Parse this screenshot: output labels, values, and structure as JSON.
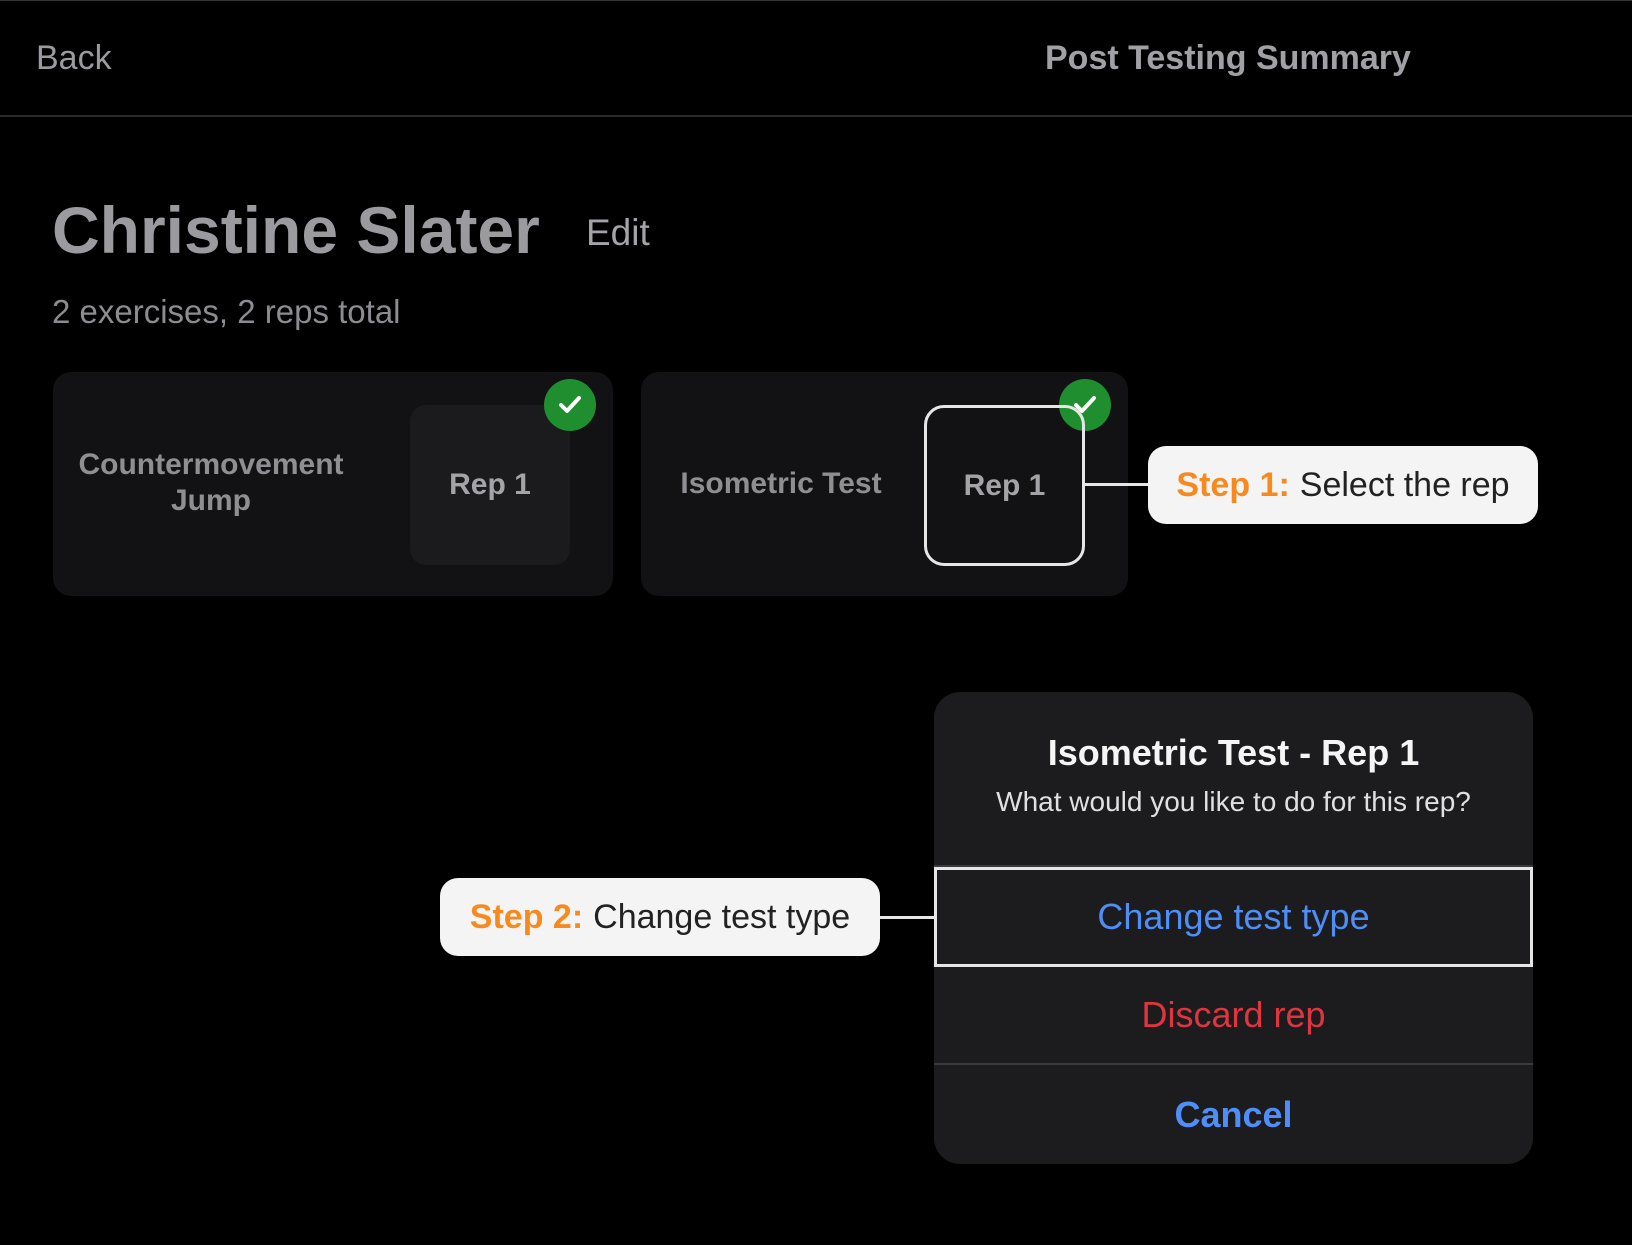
{
  "nav": {
    "back_label": "Back",
    "title": "Post Testing Summary"
  },
  "athlete": {
    "name": "Christine Slater",
    "edit_label": "Edit",
    "summary": "2 exercises, 2 reps total"
  },
  "exercises": [
    {
      "name": "Countermovement Jump",
      "rep_label": "Rep 1",
      "status_icon": "check-icon"
    },
    {
      "name": "Isometric Test",
      "rep_label": "Rep 1",
      "status_icon": "check-icon"
    }
  ],
  "callouts": {
    "step1": {
      "step": "Step 1:",
      "text": "Select the rep"
    },
    "step2": {
      "step": "Step 2:",
      "text": "Change test type"
    }
  },
  "action_sheet": {
    "title": "Isometric Test - Rep 1",
    "subtitle": "What would you like to do for this rep?",
    "change_label": "Change test type",
    "discard_label": "Discard rep",
    "cancel_label": "Cancel"
  },
  "colors": {
    "accent_blue": "#4f8ef7",
    "destructive_red": "#e0353f",
    "step_orange": "#f68a1f",
    "check_green": "#1e8e2f"
  }
}
